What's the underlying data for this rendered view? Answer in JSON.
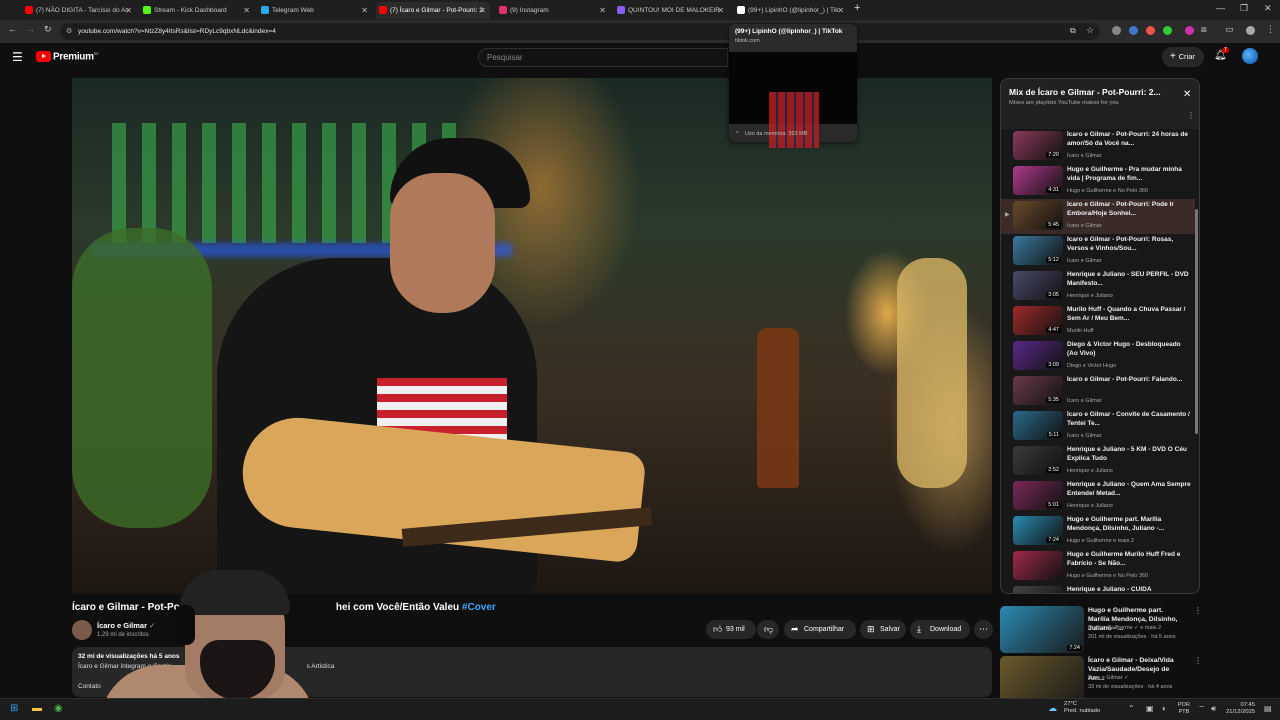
{
  "browser": {
    "tabs": [
      {
        "label": "(7) NÃO DIGITA - Tarcísio do Ac",
        "color": "#ff0000"
      },
      {
        "label": "Stream - Kick Dashboard",
        "color": "#53fc18"
      },
      {
        "label": "Telegram Web",
        "color": "#2aabee"
      },
      {
        "label": "(7) Ícaro e Gilmar - Pot-Pourri: 2",
        "color": "#ff0000"
      },
      {
        "label": "(9) Instagram",
        "color": "#e1306c"
      },
      {
        "label": "QUINTOU! MOI DE MALOKEIR",
        "color": "#8a5cf6"
      },
      {
        "label": "(99+) LipinhO (@lipinhor_) | Tik",
        "color": "#ffffff"
      }
    ],
    "url": "youtube.com/watch?v=NtzZ8y4ItsRs&list=RDyLc9qbxNLdc&index=4",
    "hover_card": {
      "title": "(99+) LipinhO (@lipinhor_) | TikTok",
      "domain": "tiktok.com",
      "memory": "Uso da memória: 393 MB"
    }
  },
  "youtube": {
    "logo_text": "Premium",
    "logo_sup": "BR",
    "search_placeholder": "Pesquisar",
    "create_label": "Criar",
    "notification_count": "7"
  },
  "video": {
    "title_left": "Ícaro e Gilmar - Pot-Pou",
    "title_right": "hei com Você/Então Valeu",
    "hashtag": "#Cover",
    "channel": "Ícaro e Gilmar",
    "subscribers": "1,29 mi de inscritos",
    "likes": "93 mil",
    "share": "Compartilhar",
    "save": "Salvar",
    "download": "Download",
    "views": "32 mi de visualizações  há 5 anos",
    "desc_left": "Ícaro e Gilmar integram o Castin",
    "desc_right": "s Artistica",
    "desc_contact": "Contato"
  },
  "playlist": {
    "title": "Mix de Ícaro e Gilmar - Pot-Pourri: 2...",
    "subtitle": "Mixes are playlists YouTube makes for you",
    "items": [
      {
        "title": "Ícaro e Gilmar - Pot-Pourri: 24 horas de amor/Só da Você na...",
        "channel": "Ícaro e Gilmar",
        "duration": "7:20",
        "thumb": "#8a3a5a"
      },
      {
        "title": "Hugo e Guilherme - Pra mudar minha vida | Programa de fim...",
        "channel": "Hugo e Guilherme e No Pelo 360",
        "duration": "4:31",
        "thumb": "#b03a8a"
      },
      {
        "title": "Ícaro e Gilmar - Pot-Pourri: Pode Ir Embora/Hoje Sonhei...",
        "channel": "Ícaro e Gilmar",
        "duration": "5:45",
        "thumb": "#6a4a2a",
        "playing": true
      },
      {
        "title": "Ícaro e Gilmar - Pot-Pourri: Rosas, Versos e Vinhos/Sou...",
        "channel": "Ícaro e Gilmar",
        "duration": "5:12",
        "thumb": "#3a7aa0"
      },
      {
        "title": "Henrique e Juliano - SEU PERFIL - DVD Manifesto...",
        "channel": "Henrique e Juliano",
        "duration": "3:05",
        "thumb": "#4a4a6a"
      },
      {
        "title": "Murilo Huff - Quando a Chuva Passar / Sem Ar / Meu Bem...",
        "channel": "Murilo Huff",
        "duration": "4:47",
        "thumb": "#a02a2a"
      },
      {
        "title": "Diego & Victor Hugo - Desbloqueado (Ao Vivo)",
        "channel": "Diego e Victor Hugo",
        "duration": "3:09",
        "thumb": "#5a2a8a"
      },
      {
        "title": "Ícaro e Gilmar - Pot-Pourri: Falando...",
        "channel": "Ícaro e Gilmar",
        "duration": "5:35",
        "thumb": "#6a3a4a"
      },
      {
        "title": "Ícaro e Gilmar - Convite de Casamento / Tentei Te...",
        "channel": "Ícaro e Gilmar",
        "duration": "5:11",
        "thumb": "#2a6a8a"
      },
      {
        "title": "Henrique e Juliano - 5 KM - DVD O Céu Explica Tudo",
        "channel": "Henrique e Juliano",
        "duration": "2:52",
        "thumb": "#3a3a3a"
      },
      {
        "title": "Henrique e Juliano - Quem Ama Sempre Entende/ Metad...",
        "channel": "Henrique e Juliano",
        "duration": "5:01",
        "thumb": "#7a2a5a"
      },
      {
        "title": "Hugo e Guilherme part. Marília Mendonça, Dilsinho, Juliano -...",
        "channel": "Hugo e Guilherme e mais 2",
        "duration": "7:24",
        "thumb": "#2a8ab0"
      },
      {
        "title": "Hugo e Guilherme Murilo Huff Fred e Fabrício - Se Não...",
        "channel": "Hugo e Guilherme e No Pelo 360",
        "duration": "",
        "thumb": "#a02a4a"
      },
      {
        "title": "Henrique e Juliano - CUIDA",
        "channel": "",
        "duration": "",
        "thumb": "#444444"
      }
    ]
  },
  "recommendations": [
    {
      "title": "Hugo e Guilherme part. Marília Mendonça, Dilsinho, Juliano - ...",
      "channel": "Hugo e Guilherme ✓ e mais 2",
      "meta": "201 mi de visualizações · há 5 anos",
      "duration": "7:24",
      "thumb": "#2a8ab0"
    },
    {
      "title": "Ícaro e Gilmar - Deixa/Vida Vazia/Saudade/Desejo de Am...",
      "channel": "Ícaro e Gilmar ✓",
      "meta": "33 mi de visualizações · há 4 anos",
      "duration": "",
      "thumb": "#6a5a2a"
    }
  ],
  "taskbar": {
    "weather_temp": "27°C",
    "weather_desc": "Pred. nublado",
    "lang_1": "POR",
    "lang_2": "PTB",
    "time": "07:45",
    "date": "21/12/2025"
  }
}
